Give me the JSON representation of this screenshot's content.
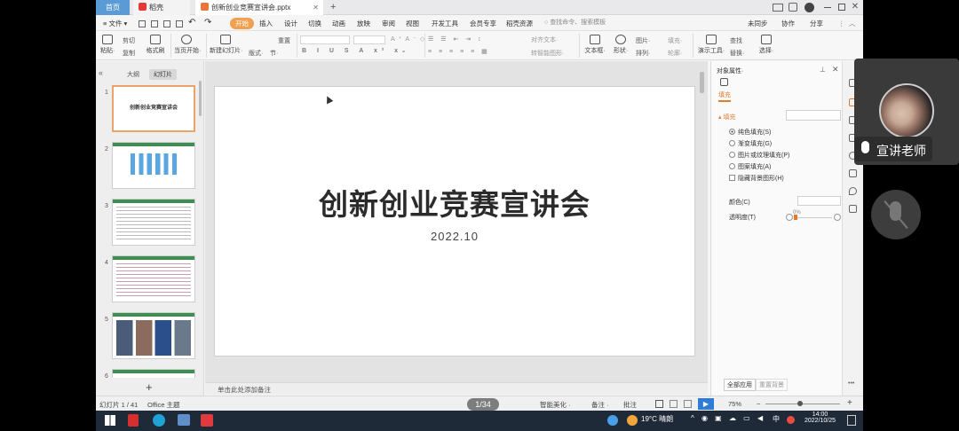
{
  "titlebar": {
    "home_tab": "首页",
    "app_tab": "稻壳",
    "file_tab": "创新创业竞赛宣讲会.pptx",
    "close_glyph": "✕",
    "add_glyph": "+"
  },
  "menu": {
    "file": "≡ 文件 ▾",
    "items": [
      "开始",
      "插入",
      "设计",
      "切换",
      "动画",
      "放映",
      "审阅",
      "视图",
      "开发工具",
      "会员专享",
      "稻壳资源"
    ],
    "search_placeholder": "查找命令、搜索模板",
    "right": [
      "未同步",
      "协作",
      "分享"
    ]
  },
  "ribbon": {
    "paste": "粘贴·",
    "cut": "剪切",
    "copy": "复制",
    "format_painter": "格式刷",
    "start_from_current": "当页开始·",
    "new_slide": "新建幻灯片·",
    "layout": "版式·",
    "section": "节·",
    "reset": "重置",
    "text_direction": "对齐文本·",
    "convert_smartart": "转智能图形·",
    "textbox": "文本框·",
    "shape": "形状·",
    "arrange": "排列·",
    "picture": "图片·",
    "fill": "填充·",
    "outline": "轮廓·",
    "presenter_tools": "演示工具·",
    "find": "查找",
    "replace": "替换·",
    "select": "选择·"
  },
  "left_panel": {
    "tab_outline": "大纲",
    "tab_slides": "幻灯片",
    "slide_numbers": [
      "1",
      "2",
      "3",
      "4",
      "5",
      "6"
    ],
    "thumb1_title": "创新创业竞赛宣讲会",
    "add_glyph": "+"
  },
  "slide": {
    "title": "创新创业竞赛宣讲会",
    "date": "2022.10"
  },
  "notes": {
    "placeholder": "单击此处添加备注"
  },
  "object_pane": {
    "header": "对象属性·",
    "tab": "填充",
    "section_fill": "填充",
    "options": [
      "纯色填充(S)",
      "渐变填充(G)",
      "图片或纹理填充(P)",
      "图案填充(A)"
    ],
    "selected_option": "纯色填充(S)",
    "hide_bg": "隐藏背景图形(H)",
    "color_label": "颜色(C)",
    "transparency_label": "透明度(T)",
    "transparency_value": "0%",
    "apply_all": "全部应用",
    "reset_bg": "重置背景"
  },
  "status": {
    "slide_info": "幻灯片 1 / 41",
    "theme": "Office 主题",
    "page_badge": "1/34",
    "beautify": "智能美化 ·",
    "notes": "备注 ·",
    "comments": "批注",
    "zoom": "75%"
  },
  "taskbar": {
    "weather": "19°C 晴朗",
    "ime": "中",
    "time": "14:00",
    "date": "2022/10/25"
  },
  "overlay": {
    "teacher_name": "宣讲老师"
  }
}
